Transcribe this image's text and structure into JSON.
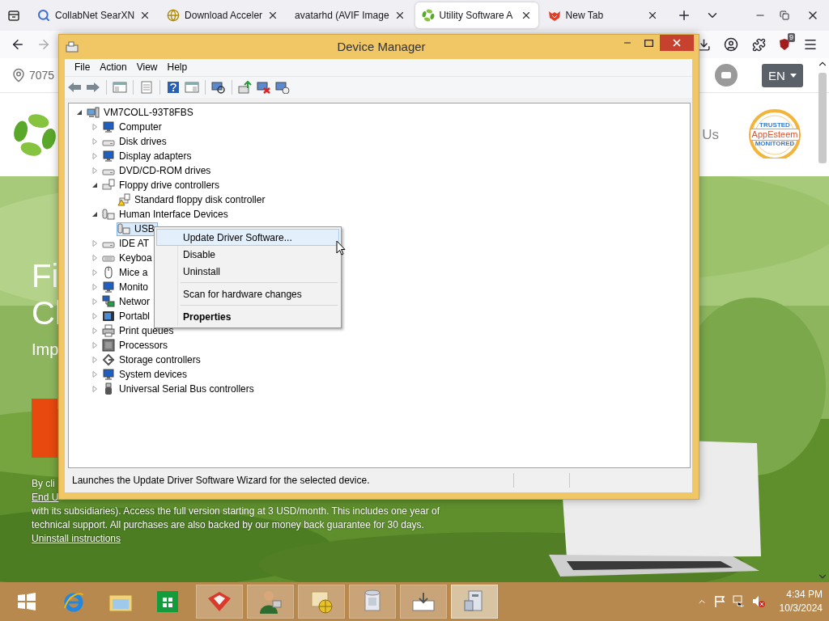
{
  "browser": {
    "tabs": [
      {
        "title": "CollabNet SearXN",
        "selected": false
      },
      {
        "title": "Download Acceler",
        "selected": false
      },
      {
        "title": "avatarhd (AVIF Image",
        "selected": false
      },
      {
        "title": "Utility Software A",
        "selected": true
      },
      {
        "title": "New Tab",
        "selected": false
      }
    ],
    "extension_badge": "9"
  },
  "page": {
    "location": "7075",
    "language": "EN",
    "nav_link": "Us",
    "badge": {
      "top": "TRUSTED",
      "name": "AppEsteem",
      "bottom": "MONITORED"
    },
    "hero": {
      "title_lines": [
        "Fi",
        "Cl"
      ],
      "subtitle": "Imp"
    },
    "legal": [
      {
        "text": "By cli",
        "link": false
      },
      {
        "text": "End U",
        "link": true
      },
      {
        "text": "with its subsidiaries). Access the full version starting at 3 USD/month. This includes one year of",
        "link": false
      },
      {
        "text": "technical support. All purchases are also backed by our money back guarantee for 30 days.",
        "link": false
      },
      {
        "text": "Uninstall instructions",
        "link": true
      }
    ]
  },
  "device_manager": {
    "title": "Device Manager",
    "menu": [
      "File",
      "Action",
      "View",
      "Help"
    ],
    "tree": {
      "label": "VM7COLL-93T8FBS",
      "expanded": true,
      "selected": false,
      "children": [
        {
          "label": "Computer",
          "expanded": false,
          "selected": false
        },
        {
          "label": "Disk drives",
          "expanded": false,
          "selected": false
        },
        {
          "label": "Display adapters",
          "expanded": false,
          "selected": false
        },
        {
          "label": "DVD/CD-ROM drives",
          "expanded": false,
          "selected": false
        },
        {
          "label": "Floppy drive controllers",
          "expanded": true,
          "selected": false,
          "children": [
            {
              "label": "Standard floppy disk controller",
              "selected": false
            }
          ]
        },
        {
          "label": "Human Interface Devices",
          "expanded": true,
          "selected": false,
          "children": [
            {
              "label": "USB",
              "selected": true
            }
          ]
        },
        {
          "label": "IDE AT",
          "expanded": false,
          "selected": false
        },
        {
          "label": "Keyboa",
          "expanded": false,
          "selected": false
        },
        {
          "label": "Mice a",
          "expanded": false,
          "selected": false
        },
        {
          "label": "Monito",
          "expanded": false,
          "selected": false
        },
        {
          "label": "Networ",
          "expanded": false,
          "selected": false
        },
        {
          "label": "Portabl",
          "expanded": false,
          "selected": false
        },
        {
          "label": "Print queues",
          "expanded": false,
          "selected": false
        },
        {
          "label": "Processors",
          "expanded": false,
          "selected": false
        },
        {
          "label": "Storage controllers",
          "expanded": false,
          "selected": false
        },
        {
          "label": "System devices",
          "expanded": false,
          "selected": false
        },
        {
          "label": "Universal Serial Bus controllers",
          "expanded": false,
          "selected": false
        }
      ]
    },
    "context_menu": [
      {
        "kind": "item",
        "label": "Update Driver Software...",
        "selected": true,
        "default": false
      },
      {
        "kind": "item",
        "label": "Disable",
        "selected": false,
        "default": false
      },
      {
        "kind": "item",
        "label": "Uninstall",
        "selected": false,
        "default": false
      },
      {
        "kind": "separator"
      },
      {
        "kind": "item",
        "label": "Scan for hardware changes",
        "selected": false,
        "default": false
      },
      {
        "kind": "separator"
      },
      {
        "kind": "item",
        "label": "Properties",
        "selected": false,
        "default": true
      }
    ],
    "status": "Launches the Update Driver Software Wizard for the selected device."
  },
  "taskbar": {
    "time": "4:34 PM",
    "date": "10/3/2024"
  }
}
